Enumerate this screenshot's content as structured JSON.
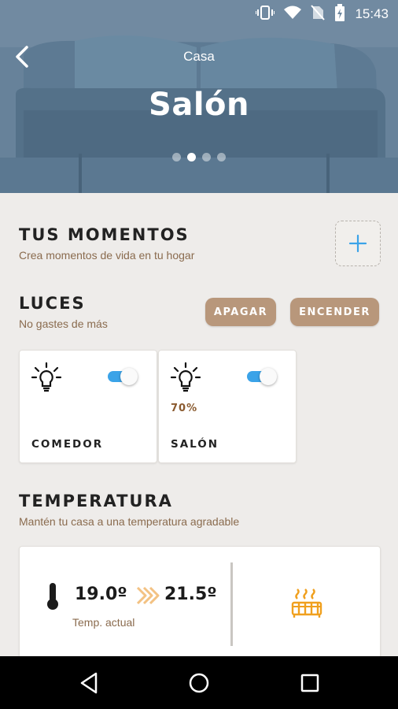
{
  "status_bar": {
    "time": "15:43"
  },
  "header": {
    "subtitle": "Casa",
    "title": "Salón",
    "page_indicator": {
      "count": 4,
      "active_index": 1
    }
  },
  "moments": {
    "title": "TUS MOMENTOS",
    "subtitle": "Crea momentos de vida en tu hogar"
  },
  "lights": {
    "title": "LUCES",
    "subtitle": "No gastes de más",
    "off_button": "APAGAR",
    "on_button": "ENCENDER",
    "cards": [
      {
        "room": "COMEDOR",
        "level": "",
        "on": true
      },
      {
        "room": "SALÓN",
        "level": "70%",
        "on": true
      }
    ]
  },
  "temperature": {
    "title": "TEMPERATURA",
    "subtitle": "Mantén tu casa a una temperatura agradable",
    "current": "19.0º",
    "target": "21.5º",
    "current_label": "Temp. actual"
  },
  "icons": {
    "back": "chevron-left-icon",
    "add": "plus-icon",
    "bulb": "lightbulb-icon",
    "thermometer": "thermometer-icon",
    "arrows": "double-chevron-right-icon",
    "heater": "radiator-icon"
  },
  "colors": {
    "accent_blue": "#3ba3e8",
    "button_brown": "#b8977b",
    "subtitle_brown": "#8a6b4e",
    "heater_orange": "#f0a01e",
    "background": "#eeecea"
  }
}
